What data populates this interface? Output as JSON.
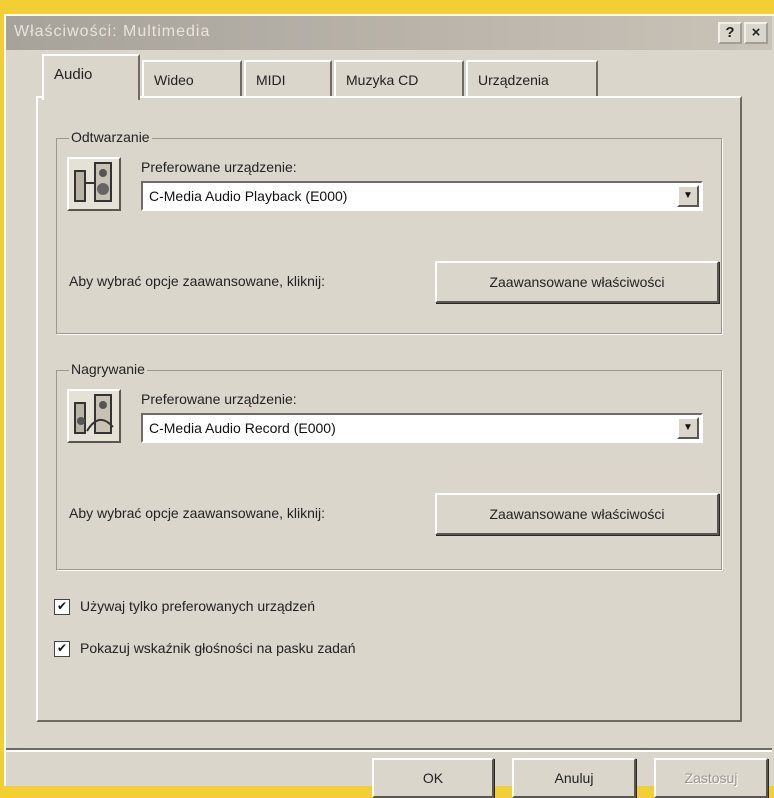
{
  "window": {
    "title": "Właściwości: Multimedia",
    "help_label": "?",
    "close_label": "×"
  },
  "tabs": [
    {
      "label": "Audio",
      "active": true
    },
    {
      "label": "Wideo",
      "active": false
    },
    {
      "label": "MIDI",
      "active": false
    },
    {
      "label": "Muzyka CD",
      "active": false
    },
    {
      "label": "Urządzenia",
      "active": false
    }
  ],
  "playback": {
    "group_label": "Odtwarzanie",
    "icon": "speaker-device-icon",
    "preferred_label": "Preferowane urządzenie:",
    "device_value": "C-Media Audio Playback (E000)",
    "hint": "Aby wybrać opcje zaawansowane, kliknij:",
    "advanced_button": "Zaawansowane właściwości"
  },
  "recording": {
    "group_label": "Nagrywanie",
    "icon": "recording-device-icon",
    "preferred_label": "Preferowane urządzenie:",
    "device_value": "C-Media Audio Record (E000)",
    "hint": "Aby wybrać opcje zaawansowane, kliknij:",
    "advanced_button": "Zaawansowane właściwości"
  },
  "options": [
    {
      "label": "Używaj tylko preferowanych urządzeń",
      "checked": true
    },
    {
      "label": "Pokazuj wskaźnik głośności na pasku zadań",
      "checked": true
    }
  ],
  "footer": {
    "ok": "OK",
    "cancel": "Anuluj",
    "apply": "Zastosuj"
  }
}
